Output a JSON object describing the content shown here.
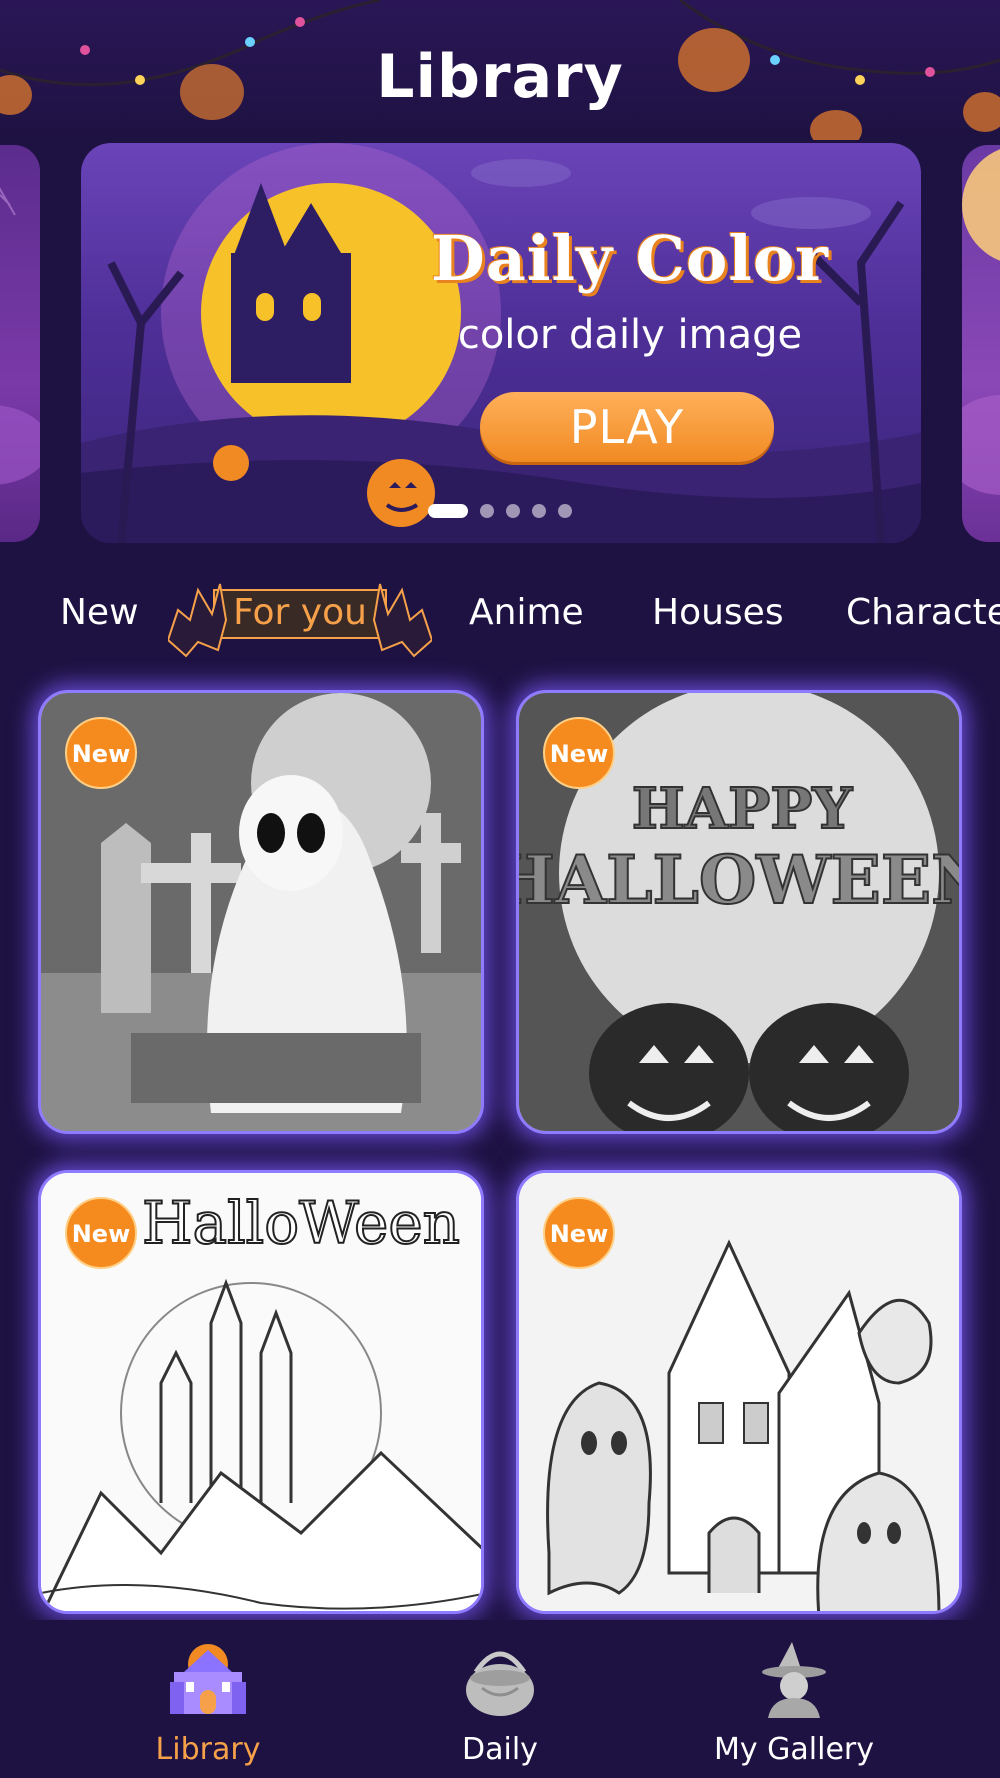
{
  "header": {
    "title": "Library"
  },
  "banner": {
    "title": "Daily Color",
    "subtitle": "color daily image",
    "play_label": "PLAY",
    "page_count": 5,
    "active_page": 1
  },
  "tabs": [
    {
      "label": "New",
      "active": false
    },
    {
      "label": "For you",
      "active": true
    },
    {
      "label": "Anime",
      "active": false
    },
    {
      "label": "Houses",
      "active": false
    },
    {
      "label": "Characte",
      "active": false
    }
  ],
  "grid": {
    "badge_label": "New",
    "items": [
      {
        "subject": "ghost-in-graveyard"
      },
      {
        "subject": "happy-halloween-pumpkins",
        "art_text_1": "HAPPY",
        "art_text_2": "HALLOWEEN"
      },
      {
        "subject": "halloween-castle-lineart",
        "art_text": "HalloWeen"
      },
      {
        "subject": "haunted-house-ghosts-lineart"
      }
    ]
  },
  "bottom_nav": {
    "items": [
      {
        "label": "Library",
        "icon": "castle-icon",
        "active": true
      },
      {
        "label": "Daily",
        "icon": "pumpkin-basket-icon",
        "active": false
      },
      {
        "label": "My Gallery",
        "icon": "witch-icon",
        "active": false
      }
    ]
  },
  "colors": {
    "background": "#1e1242",
    "accent": "#f6a14a",
    "card_glow": "#8f7bff",
    "badge": "#f58b1e"
  }
}
